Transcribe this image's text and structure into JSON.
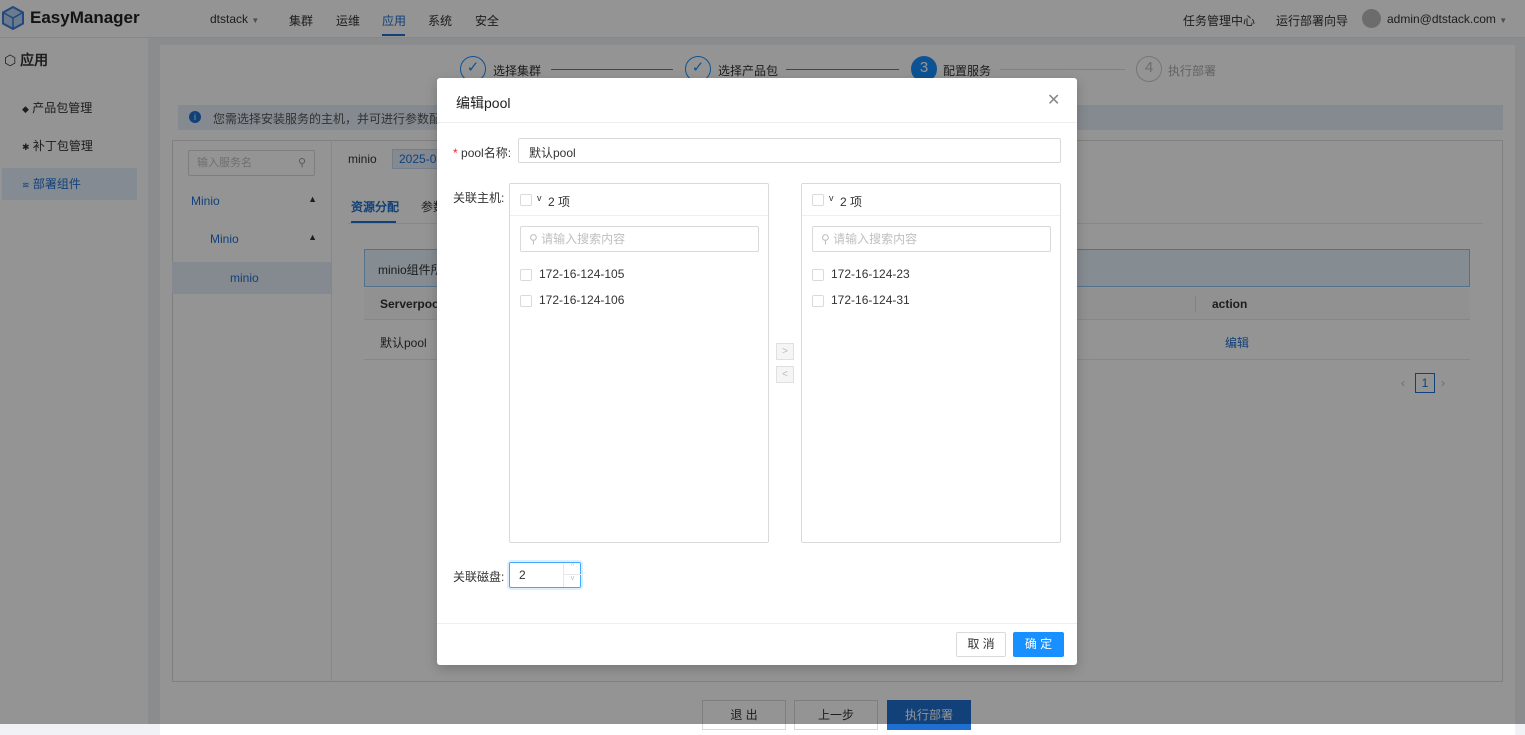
{
  "header": {
    "brand": "EasyManager",
    "tenant": "dtstack",
    "nav": [
      "集群",
      "运维",
      "应用",
      "系统",
      "安全"
    ],
    "active_nav": "应用",
    "right_links": [
      "任务管理中心",
      "运行部署向导"
    ],
    "user": "admin@dtstack.com"
  },
  "sidebar": {
    "title": "应用",
    "items": [
      {
        "label": "产品包管理"
      },
      {
        "label": "补丁包管理"
      },
      {
        "label": "部署组件"
      }
    ]
  },
  "steps": [
    {
      "label": "选择集群",
      "status": "done"
    },
    {
      "label": "选择产品包",
      "status": "done"
    },
    {
      "num": "3",
      "label": "配置服务",
      "status": "active"
    },
    {
      "num": "4",
      "label": "执行部署",
      "status": "wait"
    }
  ],
  "info_text": "您需选择安装服务的主机，并可进行参数配置",
  "service_search_placeholder": "输入服务名",
  "tree": [
    {
      "label": "Minio"
    },
    {
      "label": "Minio"
    },
    {
      "label": "minio"
    }
  ],
  "service": {
    "name": "minio",
    "version": "2025-0"
  },
  "tabs": [
    "资源分配",
    "参数"
  ],
  "alert_text": "minio组件所",
  "table": {
    "headers": [
      "Serverpool",
      "action"
    ],
    "rows": [
      {
        "name": "默认pool",
        "action": "编辑"
      }
    ]
  },
  "pagination": {
    "current": "1"
  },
  "footer_buttons": [
    "退 出",
    "上一步",
    "执行部署"
  ],
  "modal": {
    "title": "编辑pool",
    "pool_name_label": "pool名称:",
    "pool_name_value": "默认pool",
    "hosts_label": "关联主机:",
    "left_list": {
      "count": "2 项",
      "search_placeholder": "请输入搜索内容",
      "items": [
        "172-16-124-105",
        "172-16-124-106"
      ]
    },
    "right_list": {
      "count": "2 项",
      "search_placeholder": "请输入搜索内容",
      "items": [
        "172-16-124-23",
        "172-16-124-31"
      ]
    },
    "disk_label": "关联磁盘:",
    "disk_value": "2",
    "cancel": "取 消",
    "ok": "确 定"
  }
}
